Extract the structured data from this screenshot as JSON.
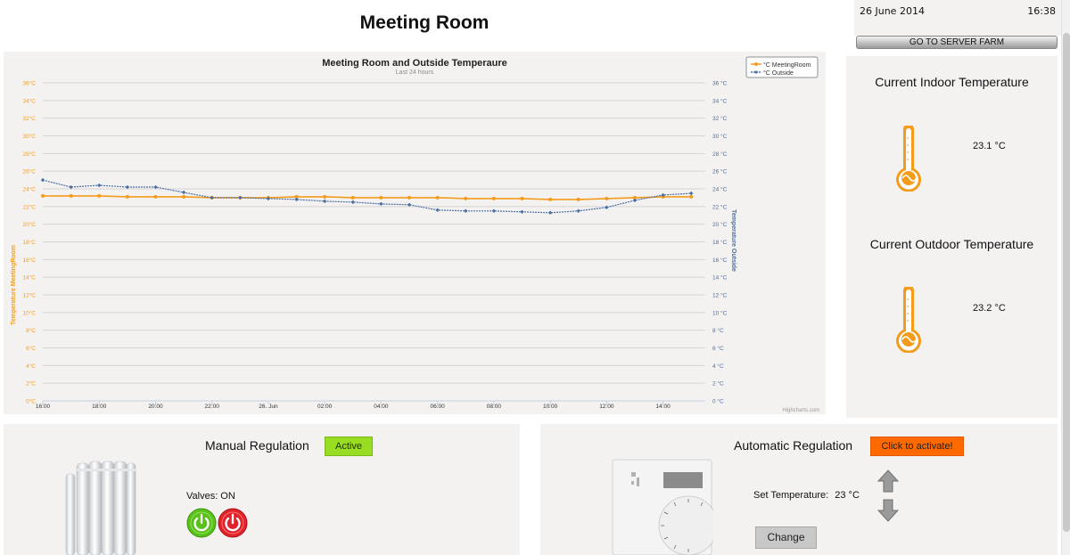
{
  "header": {
    "title": "Meeting Room"
  },
  "clock": {
    "date": "26 June 2014",
    "time": "16:38"
  },
  "nav": {
    "server_farm_label": "GO TO SERVER FARM"
  },
  "colors": {
    "meeting_room": "#f39c1c",
    "outside": "#4a6fa5",
    "active": "#99dd22",
    "activate": "#ff6a00"
  },
  "chart_data": {
    "type": "line",
    "title": "Meeting Room and Outside Temperaure",
    "subtitle": "Last 24 hours",
    "ylabel_left": "Temperature MeetingRoom",
    "ylabel_right": "Temperature Outside",
    "credits": "Highcharts.com",
    "ylim": [
      0,
      36
    ],
    "y_ticks_left": [
      "0°C",
      "2°C",
      "4°C",
      "6°C",
      "8°C",
      "10°C",
      "12°C",
      "14°C",
      "16°C",
      "18°C",
      "20°C",
      "22°C",
      "24°C",
      "26°C",
      "28°C",
      "30°C",
      "32°C",
      "34°C",
      "36°C"
    ],
    "y_ticks_right": [
      "0 °C",
      "2 °C",
      "4 °C",
      "6 °C",
      "8 °C",
      "10 °C",
      "12 °C",
      "14 °C",
      "16 °C",
      "18 °C",
      "20 °C",
      "22 °C",
      "24 °C",
      "26 °C",
      "28 °C",
      "30 °C",
      "32 °C",
      "34 °C",
      "36 °C"
    ],
    "x_ticks": [
      {
        "label": "16:00",
        "h": 0
      },
      {
        "label": "18:00",
        "h": 2
      },
      {
        "label": "20:00",
        "h": 4
      },
      {
        "label": "22:00",
        "h": 6
      },
      {
        "label": "26. Jun",
        "h": 8
      },
      {
        "label": "02:00",
        "h": 10
      },
      {
        "label": "04:00",
        "h": 12
      },
      {
        "label": "06:00",
        "h": 14
      },
      {
        "label": "08:00",
        "h": 16
      },
      {
        "label": "10:00",
        "h": 18
      },
      {
        "label": "12:00",
        "h": 20
      },
      {
        "label": "14:00",
        "h": 22
      }
    ],
    "legend_position": "top-right",
    "series": [
      {
        "name": "°C MeetingRoom",
        "x_hours": [
          0,
          1,
          2,
          3,
          4,
          5,
          6,
          7,
          8,
          9,
          10,
          11,
          12,
          13,
          14,
          15,
          16,
          17,
          18,
          19,
          20,
          21,
          22,
          23
        ],
        "values": [
          23.2,
          23.2,
          23.2,
          23.1,
          23.1,
          23.1,
          23.0,
          23.0,
          23.0,
          23.1,
          23.1,
          23.0,
          23.0,
          23.0,
          23.0,
          22.9,
          22.9,
          22.9,
          22.8,
          22.8,
          22.9,
          23.0,
          23.1,
          23.1
        ]
      },
      {
        "name": "°C Outside",
        "x_hours": [
          0,
          1,
          2,
          3,
          4,
          5,
          6,
          7,
          8,
          9,
          10,
          11,
          12,
          13,
          14,
          15,
          16,
          17,
          18,
          19,
          20,
          21,
          22,
          23
        ],
        "values": [
          25.0,
          24.2,
          24.4,
          24.2,
          24.2,
          23.6,
          23.0,
          23.0,
          22.9,
          22.8,
          22.6,
          22.5,
          22.3,
          22.2,
          21.6,
          21.5,
          21.5,
          21.4,
          21.3,
          21.5,
          21.9,
          22.7,
          23.3,
          23.5
        ]
      }
    ]
  },
  "indoor": {
    "title": "Current Indoor Temperature",
    "value": "23.1 °C"
  },
  "outdoor": {
    "title": "Current Outdoor Temperature",
    "value": "23.2 °C"
  },
  "manual": {
    "title": "Manual Regulation",
    "status_label": "Active",
    "valves_label": "Valves: ON"
  },
  "automatic": {
    "title": "Automatic Regulation",
    "activate_label": "Click to activate!",
    "set_temperature_label": "Set Temperature:",
    "set_temperature_value": "23 °C",
    "change_label": "Change"
  }
}
